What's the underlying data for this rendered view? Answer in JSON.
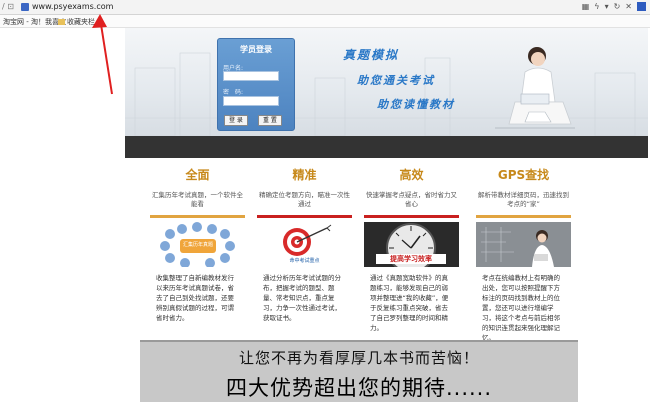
{
  "browser": {
    "url": "www.psyexams.com",
    "favorites": [
      {
        "label": "淘宝网 - 淘！我喜欢"
      },
      {
        "label": "收藏夹栏"
      }
    ]
  },
  "banner": {
    "login": {
      "title": "学员登录",
      "username_label": "用户名:",
      "password_label": "密　码:",
      "login_button": "登 录",
      "reset_button": "重 置"
    },
    "slogans": [
      "真题模拟",
      "助您通关考试",
      "助您读懂教材"
    ]
  },
  "features": [
    {
      "title": "全面",
      "desc": "汇集历年考试真题，一个软件全能看",
      "img_text": "汇集历年真题",
      "body": "收集整理了自新编教材发行以来历年考试真题试卷，省去了自己到处找试题，还要辨别真假试题的过程，可谓省时省力。"
    },
    {
      "title": "精准",
      "desc": "精确定位考题方向，瞄准一次性通过",
      "img_text": "命中考试重点",
      "body": "通过分析历年考试试题的分布，把握考试的题型、题量、常考知识点，重点复习，力争一次性通过考试，获取证书。"
    },
    {
      "title": "高效",
      "desc": "快速掌握考点疑点，省时省力又省心",
      "img_text": "提高学习效率",
      "body": "通过《真题宽助软件》的真题练习，能够发现自己的弱项并整理进“我的收藏”，便于反复练习重点突破，省去了自己罗列整理的时间和精力。"
    },
    {
      "title": "GPS查找",
      "desc": "解析带教材详细页码，迅速找到考点的“家”",
      "img_text": "",
      "body": "考点在统编教材上有明确的出处，您可以按照提醒下方标注的页码找到教材上的位置，您还可以进行增编学习，将这个考点与前后相邻的知识连贯起来强化理解记忆。"
    }
  ],
  "bottom": {
    "line1": "让您不再为看厚厚几本书而苦恼！",
    "line2": "四大优势超出您的期待......"
  },
  "colors": {
    "feature_title": "#c7891b",
    "slogan": "#2a78c7",
    "annotation_arrow": "#e02020"
  }
}
